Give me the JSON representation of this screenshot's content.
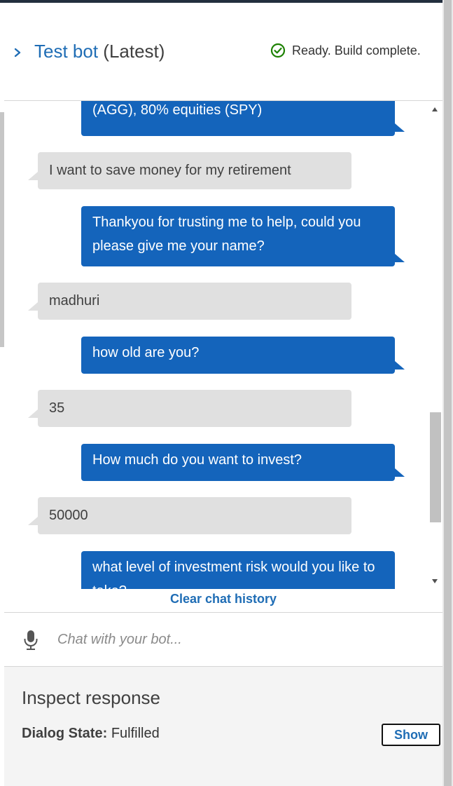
{
  "header": {
    "title_link": "Test bot",
    "title_suffix": "(Latest)",
    "status": "Ready. Build complete."
  },
  "messages": [
    {
      "from": "bot",
      "text": "(AGG), 80% equities (SPY)"
    },
    {
      "from": "user",
      "text": "I want to save money for my retirement"
    },
    {
      "from": "bot",
      "text": "Thankyou for trusting me to help, could you please give me your name?"
    },
    {
      "from": "user",
      "text": "madhuri"
    },
    {
      "from": "bot",
      "text": "how old are you?"
    },
    {
      "from": "user",
      "text": "35"
    },
    {
      "from": "bot",
      "text": "How much do you want to invest?"
    },
    {
      "from": "user",
      "text": "50000"
    },
    {
      "from": "bot",
      "text": "what level of investment risk would you like to take?"
    }
  ],
  "clear_history_label": "Clear chat history",
  "input": {
    "placeholder": "Chat with your bot...",
    "value": ""
  },
  "inspect": {
    "title": "Inspect response",
    "dialog_state_label": "Dialog State:",
    "dialog_state_value": "Fulfilled",
    "show_label": "Show"
  },
  "icons": {
    "expand": "chevron-right-icon",
    "status": "check-circle-icon",
    "mic": "microphone-icon"
  },
  "colors": {
    "bot_bubble": "#1464bb",
    "user_bubble": "#e0e0e0",
    "link": "#1f6db5",
    "success": "#1d8102"
  }
}
